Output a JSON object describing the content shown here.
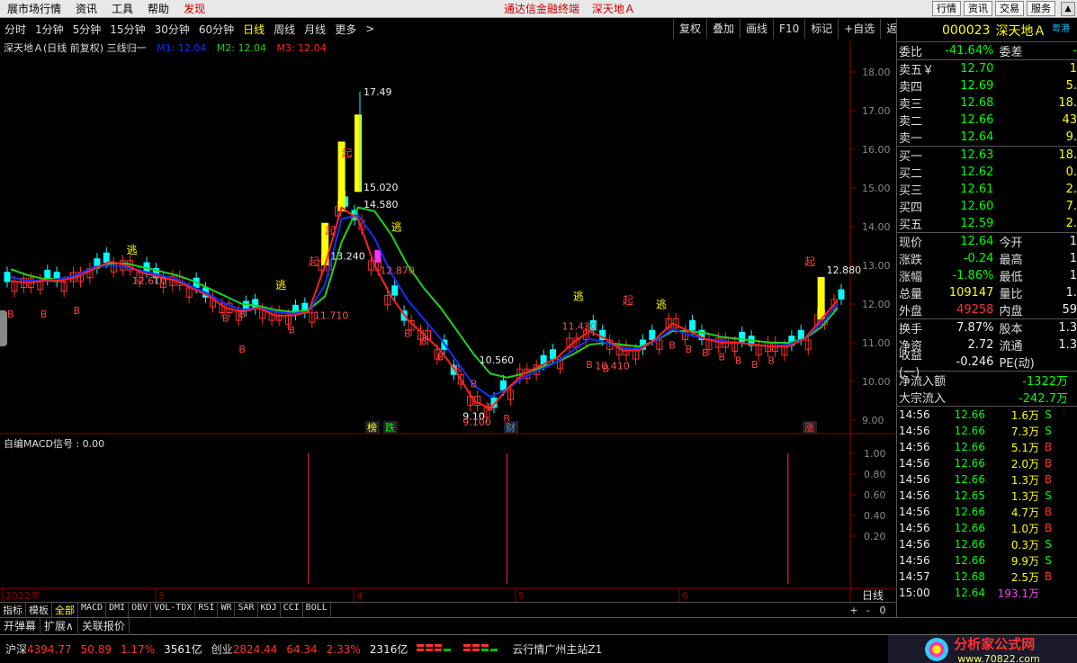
{
  "menu": {
    "items": [
      "展市场行情",
      "资讯",
      "工具",
      "帮助",
      "发现"
    ],
    "center": [
      "通达信金融终端",
      "深天地Ａ"
    ],
    "right_buttons": [
      "行情",
      "资讯",
      "交易",
      "服务"
    ]
  },
  "periods": [
    "分时",
    "1分钟",
    "5分钟",
    "15分钟",
    "30分钟",
    "60分钟",
    "日线",
    "周线",
    "月线",
    "更多",
    ">"
  ],
  "active_period": "日线",
  "right_tools": [
    "复权",
    "叠加",
    "画线",
    "F10",
    "标记",
    "+自选",
    "返回"
  ],
  "legend": {
    "title": "深天地Ａ(日线 前复权) 三线归一",
    "m1": "M1: 12.04",
    "m2": "M2: 12.04",
    "m3": "M3: 12.04"
  },
  "macd_label": "自编MACD信号 : 0.00",
  "chart_data": {
    "type": "line",
    "price_axis": [
      "18.00",
      "17.00",
      "16.00",
      "15.00",
      "14.00",
      "13.00",
      "12.00",
      "11.00",
      "10.00",
      "9.00"
    ],
    "macd_axis": [
      "1.00",
      "0.80",
      "0.60",
      "0.40",
      "0.20"
    ],
    "month_labels": [
      "2022年",
      "3",
      "4",
      "5",
      "6"
    ],
    "price_annotations": [
      "17.49",
      "15.020",
      "14.580",
      "13.240",
      "12.870",
      "12.610",
      "11.710",
      "11.430",
      "10.560",
      "10.410",
      "9.10",
      "9.100",
      "12.880"
    ],
    "signal_labels": [
      "逃",
      "逃",
      "逃",
      "逃",
      "逃",
      "起",
      "起",
      "起",
      "起",
      "起"
    ],
    "event_labels": [
      "榜",
      "跌",
      "财",
      "涨"
    ],
    "axis_bottom_label": "日线",
    "series": [
      {
        "name": "M1",
        "color": "#ff2020",
        "values": [
          12.6,
          12.55,
          12.6,
          12.6,
          12.7,
          12.9,
          13.1,
          13.0,
          12.8,
          12.7,
          12.6,
          12.4,
          12.2,
          11.9,
          11.8,
          11.9,
          11.7,
          11.7,
          11.8,
          13.0,
          14.5,
          14.2,
          13.0,
          12.2,
          11.6,
          11.2,
          10.8,
          10.2,
          9.5,
          9.3,
          9.8,
          10.2,
          10.4,
          10.6,
          11.0,
          11.3,
          11.1,
          10.8,
          10.8,
          11.1,
          11.5,
          11.3,
          11.1,
          11.0,
          11.0,
          10.95,
          10.9,
          10.9,
          11.1,
          11.6,
          12.1
        ]
      },
      {
        "name": "M2",
        "color": "#1030ff",
        "values": [
          12.7,
          12.6,
          12.6,
          12.65,
          12.75,
          12.95,
          13.0,
          12.95,
          12.85,
          12.75,
          12.65,
          12.45,
          12.25,
          12.0,
          11.85,
          11.9,
          11.8,
          11.75,
          11.8,
          12.5,
          14.2,
          14.3,
          13.7,
          12.8,
          12.1,
          11.6,
          11.1,
          10.5,
          9.9,
          9.6,
          9.8,
          10.1,
          10.3,
          10.5,
          10.8,
          11.1,
          11.0,
          10.85,
          10.85,
          11.05,
          11.35,
          11.2,
          11.1,
          11.05,
          11.0,
          10.95,
          10.9,
          10.95,
          11.1,
          11.5,
          12.0
        ]
      },
      {
        "name": "M3",
        "color": "#20d020",
        "values": [
          12.9,
          12.75,
          12.65,
          12.65,
          12.75,
          12.95,
          13.05,
          13.05,
          12.95,
          12.85,
          12.75,
          12.6,
          12.4,
          12.2,
          12.0,
          11.95,
          11.85,
          11.8,
          11.85,
          12.2,
          13.6,
          14.5,
          14.4,
          13.8,
          13.0,
          12.4,
          11.9,
          11.3,
          10.7,
          10.2,
          10.1,
          10.2,
          10.35,
          10.5,
          10.7,
          10.95,
          11.0,
          10.95,
          10.9,
          11.05,
          11.3,
          11.3,
          11.25,
          11.15,
          11.1,
          11.05,
          11.0,
          11.0,
          11.1,
          11.4,
          11.9
        ]
      }
    ],
    "macd_signals": [
      {
        "x": 18,
        "value": 1.0
      },
      {
        "x": 30,
        "value": 1.0
      },
      {
        "x": 47,
        "value": 1.0
      }
    ]
  },
  "quote": {
    "code": "000023",
    "name": "深天地Ａ",
    "tag": "粤港",
    "webi_label": "委比",
    "webi": "-41.64%",
    "weicha_label": "委差",
    "weicha": "-",
    "sells": [
      {
        "label": "卖五",
        "mark": "￥",
        "price": "12.70",
        "vol": "1"
      },
      {
        "label": "卖四",
        "mark": "",
        "price": "12.69",
        "vol": "5."
      },
      {
        "label": "卖三",
        "mark": "",
        "price": "12.68",
        "vol": "18."
      },
      {
        "label": "卖二",
        "mark": "",
        "price": "12.66",
        "vol": "43"
      },
      {
        "label": "卖一",
        "mark": "",
        "price": "12.64",
        "vol": "9."
      }
    ],
    "buys": [
      {
        "label": "买一",
        "price": "12.63",
        "vol": "18."
      },
      {
        "label": "买二",
        "price": "12.62",
        "vol": "0."
      },
      {
        "label": "买三",
        "price": "12.61",
        "vol": "2."
      },
      {
        "label": "买四",
        "price": "12.60",
        "vol": "7."
      },
      {
        "label": "买五",
        "price": "12.59",
        "vol": "2."
      }
    ],
    "stats": [
      {
        "l1": "现价",
        "v1": "12.64",
        "c1": "grn",
        "l2": "今开",
        "v2": "1"
      },
      {
        "l1": "涨跌",
        "v1": "-0.24",
        "c1": "grn",
        "l2": "最高",
        "v2": "1"
      },
      {
        "l1": "涨幅",
        "v1": "-1.86%",
        "c1": "grn",
        "l2": "最低",
        "v2": "1"
      },
      {
        "l1": "总量",
        "v1": "109147",
        "c1": "yel",
        "l2": "量比",
        "v2": "1."
      },
      {
        "l1": "外盘",
        "v1": "49258",
        "c1": "red",
        "l2": "内盘",
        "v2": "59"
      }
    ],
    "stats2": [
      {
        "l1": "换手",
        "v1": "7.87%",
        "c1": "wht",
        "l2": "股本",
        "v2": "1.3"
      },
      {
        "l1": "净资",
        "v1": "2.72",
        "c1": "wht",
        "l2": "流通",
        "v2": "1.3"
      },
      {
        "l1": "收益(一)",
        "v1": "-0.246",
        "c1": "wht",
        "l2": "PE(动)",
        "v2": ""
      }
    ],
    "flows": [
      {
        "label": "净流入额",
        "value": "-1322万"
      },
      {
        "label": "大宗流入",
        "value": "-242.7万"
      }
    ],
    "ticks": [
      {
        "t": "14:56",
        "p": "12.66",
        "v": "1.6万",
        "d": "S"
      },
      {
        "t": "14:56",
        "p": "12.66",
        "v": "7.3万",
        "d": "S"
      },
      {
        "t": "14:56",
        "p": "12.66",
        "v": "5.1万",
        "d": "B"
      },
      {
        "t": "14:56",
        "p": "12.66",
        "v": "2.0万",
        "d": "B"
      },
      {
        "t": "14:56",
        "p": "12.66",
        "v": "1.3万",
        "d": "B"
      },
      {
        "t": "14:56",
        "p": "12.65",
        "v": "1.3万",
        "d": "S"
      },
      {
        "t": "14:56",
        "p": "12.66",
        "v": "4.7万",
        "d": "B"
      },
      {
        "t": "14:56",
        "p": "12.66",
        "v": "1.0万",
        "d": "B"
      },
      {
        "t": "14:56",
        "p": "12.66",
        "v": "0.3万",
        "d": "S"
      },
      {
        "t": "14:56",
        "p": "12.66",
        "v": "9.9万",
        "d": "S"
      },
      {
        "t": "14:57",
        "p": "12.68",
        "v": "2.5万",
        "d": "B"
      },
      {
        "t": "15:00",
        "p": "12.64",
        "v": "193.1万",
        "d": ""
      }
    ]
  },
  "indicator_tabs": [
    "指标",
    "模板",
    "全部",
    "MACD",
    "DMI",
    "OBV",
    "VOL-TDX",
    "RSI",
    "WR",
    "SAR",
    "KDJ",
    "CCI",
    "BOLL"
  ],
  "active_indicator_tab": "全部",
  "indicator_controls": [
    "+",
    "-",
    "0"
  ],
  "sub_tabs": [
    "开弹幕",
    "扩展∧",
    "关联报价"
  ],
  "status": {
    "sh_label": "沪深",
    "sh_value": "4394.77",
    "sh_change": "50.89",
    "sh_pct": "1.17%",
    "sh_amount": "3561亿",
    "cy_label": "创业",
    "cy_value": "2824.44",
    "cy_change": "64.34",
    "cy_pct": "2.33%",
    "cy_amount": "2316亿",
    "server": "云行情广州主站Z1",
    "logo_text": "分析家公式网",
    "logo_url": "www.70822.com"
  }
}
